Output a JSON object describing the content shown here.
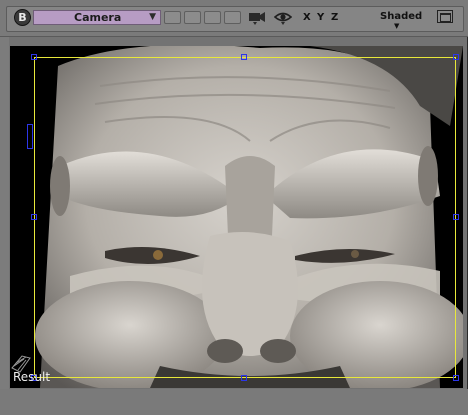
{
  "toolbar": {
    "b_label": "B",
    "camera_label": "Camera",
    "axes": [
      "X",
      "Y",
      "Z"
    ],
    "shading_label": "Shaded"
  },
  "viewport": {
    "result_label": "Result"
  },
  "colors": {
    "camera_select_bg": "#b79cc4",
    "selection_border": "#e8e83a",
    "handle_color": "#2d36e8"
  },
  "icons": [
    "camera-icon",
    "eye-icon",
    "maximize-icon",
    "dropdown-arrow-icon",
    "grid-icon"
  ]
}
